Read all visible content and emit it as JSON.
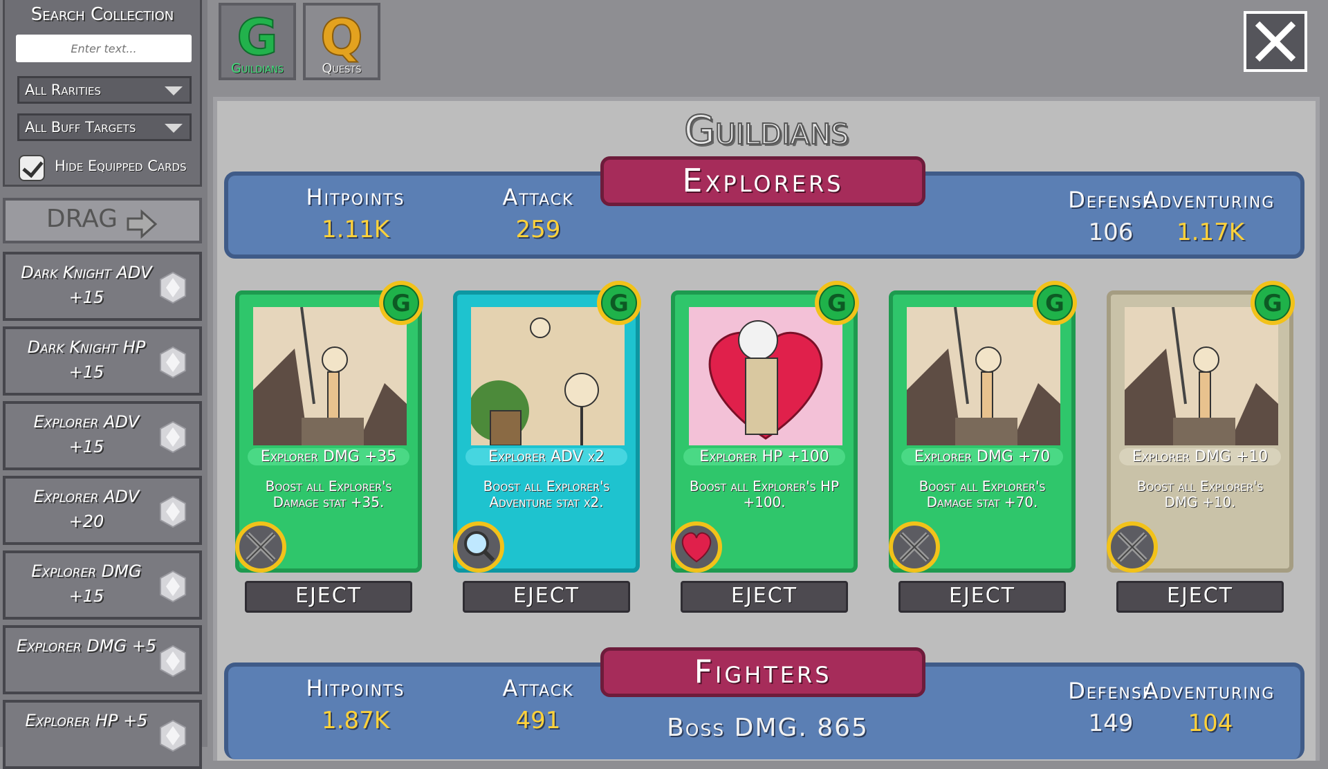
{
  "sidebar": {
    "search_title": "Search Collection",
    "search_placeholder": "Enter text...",
    "rarity_filter": "All Rarities",
    "buff_filter": "All Buff Targets",
    "hide_equipped_label": "Hide Equipped Cards",
    "hide_equipped_checked": true,
    "drag_label": "DRAG",
    "cards": [
      {
        "label": "Dark Knight ADV +15"
      },
      {
        "label": "Dark Knight HP +15"
      },
      {
        "label": "Explorer ADV +15"
      },
      {
        "label": "Explorer ADV +20"
      },
      {
        "label": "Explorer DMG +15"
      },
      {
        "label": "Explorer DMG +5"
      },
      {
        "label": "Explorer HP +5"
      }
    ]
  },
  "tabs": [
    {
      "letter": "G",
      "label": "Guildians",
      "color": "#22b24c",
      "active": true
    },
    {
      "letter": "Q",
      "label": "Quests",
      "color": "#d99a1e",
      "active": false
    }
  ],
  "panel_title": "Guildians",
  "explorers": {
    "name": "Explorers",
    "hitpoints_label": "Hitpoints",
    "hitpoints": "1.11K",
    "attack_label": "Attack",
    "attack": "259",
    "defense_label": "Defense",
    "defense": "106",
    "adventuring_label": "Adventuring",
    "adventuring": "1.17K"
  },
  "cards": [
    {
      "title": "Explorer DMG +35",
      "desc": "Boost all Explorer's Damage stat +35.",
      "color": "green",
      "icon": "swords-icon",
      "art": "climber",
      "eject": "EJECT"
    },
    {
      "title": "Explorer ADV x2",
      "desc": "Boost all Explorer's Adventure stat x2.",
      "color": "cyan",
      "icon": "magnifier-icon",
      "art": "treasure",
      "eject": "EJECT"
    },
    {
      "title": "Explorer HP +100",
      "desc": "Boost all Explorer's HP +100.",
      "color": "green",
      "icon": "heart-icon",
      "art": "heart",
      "eject": "EJECT"
    },
    {
      "title": "Explorer DMG +70",
      "desc": "Boost all Explorer's Damage stat +70.",
      "color": "green",
      "icon": "swords-icon",
      "art": "climber",
      "eject": "EJECT"
    },
    {
      "title": "Explorer DMG +10",
      "desc": "Boost all Explorer's DMG +10.",
      "color": "beige",
      "icon": "swords-icon",
      "art": "climber",
      "eject": "EJECT"
    }
  ],
  "fighters": {
    "name": "Fighters",
    "hitpoints_label": "Hitpoints",
    "hitpoints": "1.87K",
    "attack_label": "Attack",
    "attack": "491",
    "defense_label": "Defense",
    "defense": "149",
    "adventuring_label": "Adventuring",
    "adventuring": "104",
    "boss_dmg": "Boss DMG. 865"
  },
  "colors": {
    "green": "#2fc66b",
    "cyan": "#1ec3cf",
    "beige": "#c9c2a8",
    "banner": "#a62c5a",
    "stat_bar": "#5b7fb4"
  }
}
